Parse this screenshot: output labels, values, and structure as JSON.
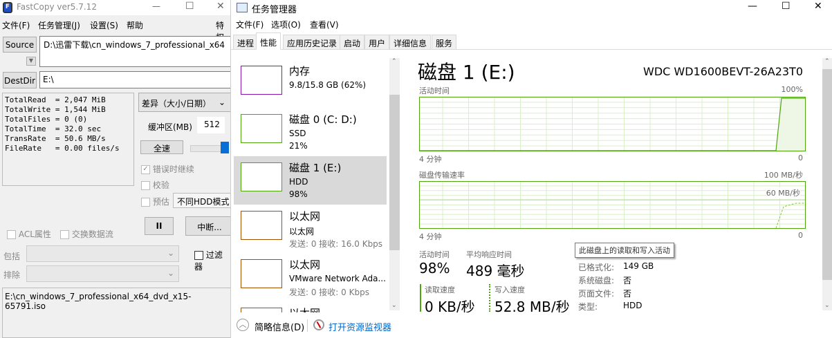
{
  "fastcopy": {
    "title": "FastCopy ver5.7.12",
    "menu": [
      "文件(F)",
      "任务管理(J)",
      "设置(S)",
      "帮助",
      "特权"
    ],
    "source_label": "Source",
    "source_value": "D:\\迅雷下载\\cn_windows_7_professional_x64",
    "destdir_label": "DestDir",
    "destdir_value": "E:\\",
    "stats": [
      "TotalRead  = 2,047 MiB",
      "TotalWrite = 1,544 MiB",
      "TotalFiles = 0 (0)",
      "TotalTime  = 32.0 sec",
      "TransRate  = 50.6 MB/s",
      "FileRate   = 0.00 files/s"
    ],
    "mode": "差异（大小/日期）",
    "buffer_label": "缓冲区(MB)",
    "buffer_value": "512",
    "speed_label": "全速",
    "speed_level": 1.0,
    "continue_on_error": "错误时继续",
    "verify": "校验",
    "estimate": "预估",
    "hdd_mode": "不同HDD模式",
    "pause_label": "II",
    "abort_label": "中断...",
    "acl": "ACL属性",
    "streams": "交换数据流",
    "filter": "过滤器",
    "include": "包括",
    "exclude": "排除",
    "log": "E:\\cn_windows_7_professional_x64_dvd_x15-65791.iso"
  },
  "taskmgr": {
    "title": "任务管理器",
    "menu": [
      "文件(F)",
      "选项(O)",
      "查看(V)"
    ],
    "tabs": [
      "进程",
      "性能",
      "应用历史记录",
      "启动",
      "用户",
      "详细信息",
      "服务"
    ],
    "items": [
      {
        "name": "内存",
        "sub1": "9.8/15.8 GB (62%)",
        "sub2": "",
        "color": "#8b12ae"
      },
      {
        "name": "磁盘 0 (C: D:)",
        "sub1": "SSD",
        "sub2": "21%",
        "color": "#4da60c"
      },
      {
        "name": "磁盘 1 (E:)",
        "sub1": "HDD",
        "sub2": "98%",
        "color": "#4da60c"
      },
      {
        "name": "以太网",
        "sub1": "以太网",
        "sub2": "发送: 0 接收: 16.0 Kbps",
        "color": "#a74f01"
      },
      {
        "name": "以太网",
        "sub1": "VMware Network Ada...",
        "sub2": "发送: 0 接收: 0 Kbps",
        "color": "#a74f01"
      },
      {
        "name": "以太网",
        "sub1": "",
        "sub2": "",
        "color": "#a74f01"
      }
    ],
    "detail": {
      "title": "磁盘 1 (E:)",
      "model": "WDC WD1600BEVT-26A23T0",
      "chart1_label": "活动时间",
      "chart1_max": "100%",
      "chart1_min": "0",
      "chart1_time": "4 分钟",
      "chart2_label": "磁盘传输速率",
      "chart2_max": "100 MB/秒",
      "chart2_line": "60 MB/秒",
      "chart2_min": "0",
      "chart2_time": "4 分钟",
      "active_label": "活动时间",
      "active_value": "98%",
      "resp_label": "平均响应时间",
      "resp_value": "489 毫秒",
      "read_label": "读取速度",
      "read_value": "0 KB/秒",
      "write_label": "写入速度",
      "write_value": "52.8 MB/秒",
      "tooltip": "此磁盘上的读取和写入活动",
      "props": [
        [
          "已格式化:",
          "149 GB"
        ],
        [
          "系统磁盘:",
          "否"
        ],
        [
          "页面文件:",
          "否"
        ],
        [
          "类型:",
          "HDD"
        ]
      ]
    },
    "footer_less": "简略信息(D)",
    "footer_monitor": "打开资源监视器",
    "accent": "#4da60c"
  }
}
